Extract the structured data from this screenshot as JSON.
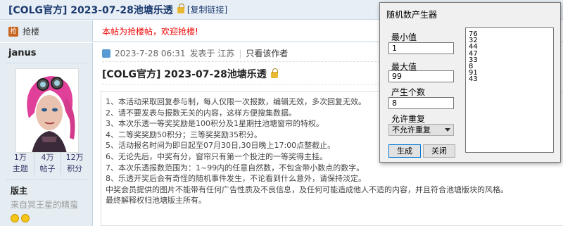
{
  "thread": {
    "title": "[COLG官方] 2023-07-28池塘乐透",
    "copy_link": "[复制链接]"
  },
  "grab": {
    "icon_text": "抢",
    "label": "抢楼",
    "notice": "本帖为抢楼帖，欢迎抢楼!"
  },
  "user": {
    "name": "janus",
    "stats": [
      {
        "value": "1万",
        "label": "主题"
      },
      {
        "value": "4万",
        "label": "帖子"
      },
      {
        "value": "12万",
        "label": "积分"
      }
    ],
    "rank": "版主",
    "rank_desc": "来自冥王星的精蛮"
  },
  "post": {
    "meta_time": "2023-7-28 06:31",
    "meta_from": "发表于 江苏",
    "meta_author_only": "只看该作者",
    "title": "[COLG官方] 2023-07-28池塘乐透",
    "lines": [
      "1、本活动采取回复参与制，每人仅限一次报数，编辑无效，多次回复无效。",
      "2、请不要发表与报数无关的内容，这样方便搜集数据。",
      "3、本次乐透一等奖奖励是100积分及1星期拄池塘窗帘的特权。",
      "4、二等奖奖励50积分；三等奖奖励35积分。",
      "5、活动报名时间为即日起至07月30日,30日晚上17:00点整截止。",
      "6、无论先后，中奖有分，窗帘只有第一个投注的一等奖得主挂。",
      "7、本次乐透报数范围为：1~99内的任意自然数，不包含带小数点的数字。",
      "8、乐透开奖后会有奇怪的随机事件发生，不论看到什么意外，请保持淡定。",
      "中奖会员提供的图片不能带有任何广告性质及不良信息，及任何可能造成他人不适的内容，并且符合池塘版块的风格。",
      "最终解释权归池塘版主所有。"
    ]
  },
  "dialog": {
    "title": "随机数产生器",
    "min_label": "最小值",
    "min_value": "1",
    "max_label": "最大值",
    "max_value": "99",
    "count_label": "产生个数",
    "count_value": "8",
    "repeat_label": "允许重复",
    "repeat_value": "不允许重复",
    "generate": "生成",
    "close": "关闭",
    "results": [
      "76",
      "32",
      "44",
      "47",
      "33",
      "8",
      "91",
      "43"
    ]
  },
  "colors": {
    "title_blue": "#1a3a6e",
    "notice_red": "#ee0000",
    "sidebar_bg": "#e5edf2",
    "border": "#c2d5e3"
  }
}
